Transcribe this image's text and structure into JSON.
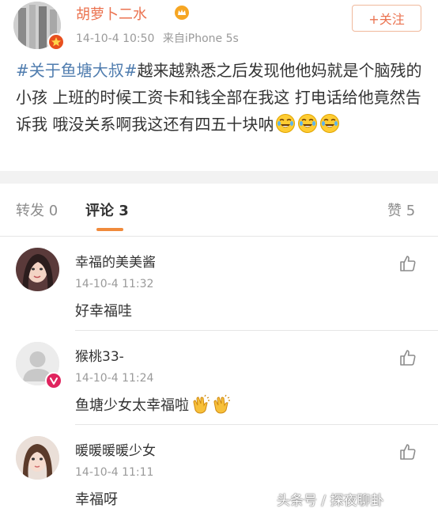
{
  "post": {
    "author": "胡萝卜二水",
    "timestamp": "14-10-4 10:50",
    "source": "来自iPhone 5s",
    "follow_label": "+关注",
    "hashtag": "#关于鱼塘大叔#",
    "body": "越来越熟悉之后发现他他妈就是个脑残的小孩 上班的时候工资卡和钱全部在我这 打电话给他竟然告诉我 哦没关系啊我这还有四五十块呐",
    "emoji": "laugh-cry-emoji",
    "emoji_count": 3
  },
  "tabs": {
    "repost": "转发 0",
    "comments": "评论 3",
    "likes": "赞 5"
  },
  "comments": [
    {
      "name": "幸福的美美酱",
      "time": "14-10-4 11:32",
      "text": "好幸福哇"
    },
    {
      "name": "猴桃33-",
      "time": "14-10-4 11:24",
      "text": "鱼塘少女太幸福啦"
    },
    {
      "name": "暖暖暖暖少女",
      "time": "14-10-4 11:11",
      "text": "幸福呀"
    }
  ],
  "watermark": "头条号 / 探夜聊卦",
  "colors": {
    "accent": "#eb7350",
    "hashtag": "#507daf",
    "tab_indicator": "#f08a3c"
  }
}
